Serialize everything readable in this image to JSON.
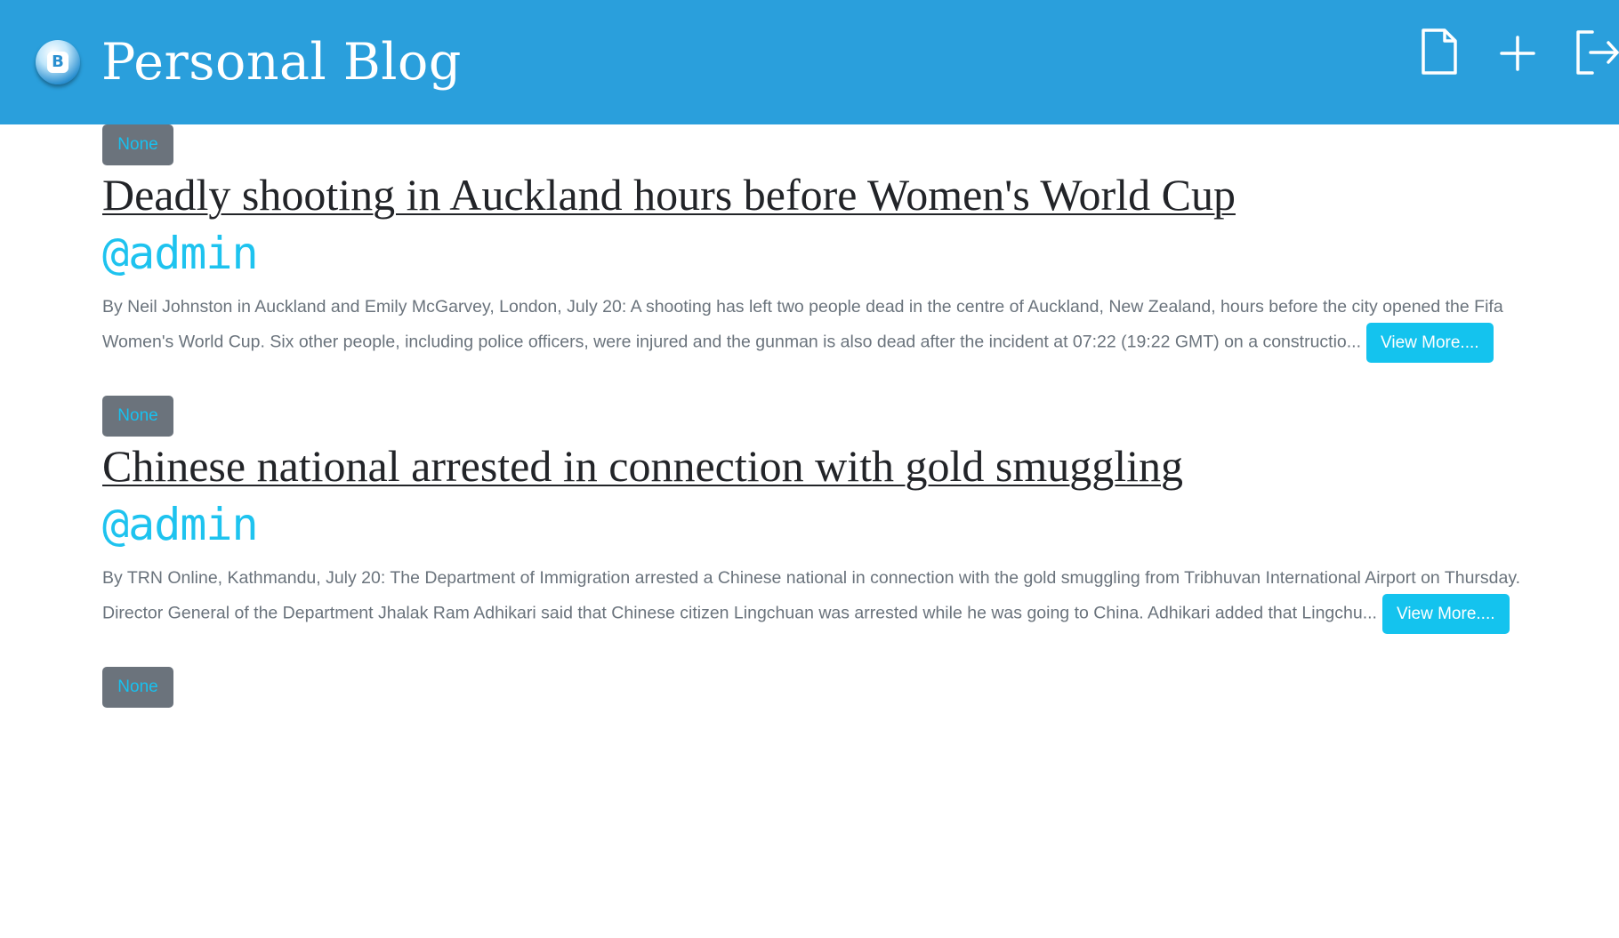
{
  "header": {
    "title": "Personal Blog",
    "logo_letter": "B",
    "icons": [
      "document-icon",
      "plus-icon",
      "logout-icon"
    ]
  },
  "colors": {
    "header_bg": "#2a9fdc",
    "badge_bg": "#6b737c",
    "accent": "#14c3ee",
    "title_text": "#222428",
    "body_text": "#6a737c"
  },
  "posts": [
    {
      "badge": "None",
      "title": "Deadly shooting in Auckland hours before Women's World Cup",
      "author": "@admin",
      "excerpt": "By Neil Johnston in Auckland and Emily McGarvey, London, July 20: A shooting has left two people dead in the centre of Auckland, New Zealand, hours before the city opened the Fifa Women's World Cup. Six other people, including police officers, were injured and the gunman is also dead after the incident at 07:22 (19:22 GMT) on a constructio...",
      "view_more": "View More...."
    },
    {
      "badge": "None",
      "title": "Chinese national arrested in connection with gold smuggling",
      "author": "@admin",
      "excerpt": "By TRN Online, Kathmandu, July 20: The Department of Immigration arrested a Chinese national in connection with the gold smuggling from Tribhuvan International Airport on Thursday. Director General of the Department Jhalak Ram Adhikari said that Chinese citizen Lingchuan was arrested while he was going to China. Adhikari added that Lingchu...",
      "view_more": "View More...."
    },
    {
      "badge": "None"
    }
  ]
}
